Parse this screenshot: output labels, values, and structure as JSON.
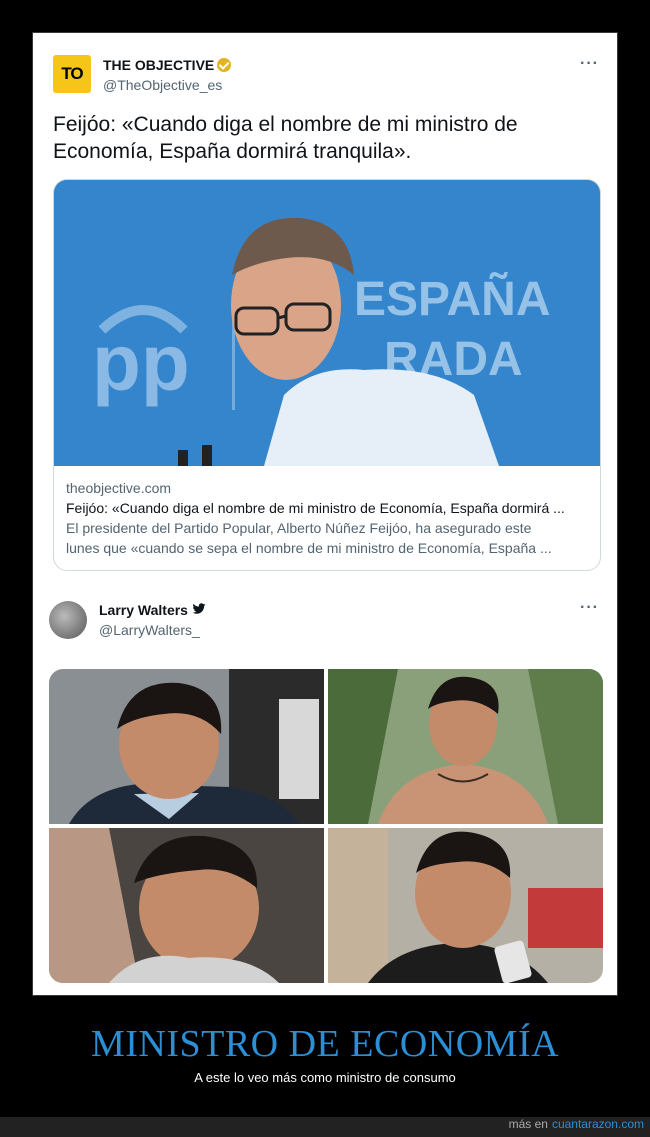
{
  "tweet1": {
    "logo_text": "TO",
    "name": "THE OBJECTIVE",
    "handle": "@TheObjective_es",
    "more": "···",
    "text": "Feijóo: «Cuando diga el nombre de mi ministro de Economía, España dormirá tranquila».",
    "card": {
      "image_text_brand": "pp",
      "image_text_banner_1": "ESPAÑA",
      "image_text_banner_2": "RADA",
      "domain": "theobjective.com",
      "title": "Feijóo: «Cuando diga el nombre de mi ministro de Economía, España dormirá ...",
      "desc_1": "El presidente del Partido Popular, Alberto Núñez Feijóo, ha asegurado este",
      "desc_2": "lunes que «cuando se sepa el nombre de mi ministro de Economía, España ..."
    }
  },
  "tweet2": {
    "name": "Larry Walters",
    "handle": "@LarryWalters_",
    "more": "···",
    "photos": [
      "photo-man-smiling-suit",
      "photo-man-shirtless-palm-trees",
      "photo-man-hugging",
      "photo-man-holding-phone"
    ]
  },
  "banner": {
    "title": "MINISTRO DE ECONOMÍA",
    "subtitle": "A este lo veo más como ministro de consumo"
  },
  "footer": {
    "label": "más en",
    "site": "cuantarazon.com"
  },
  "colors": {
    "accent": "#2b8fd6",
    "verified_gold": "#e1b421",
    "logo_yellow": "#f5c518"
  }
}
